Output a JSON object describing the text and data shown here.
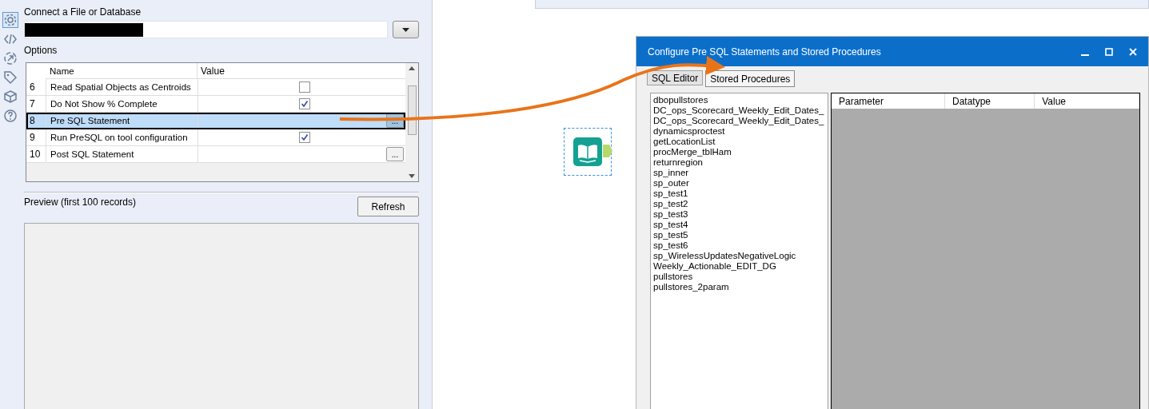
{
  "left_panel": {
    "section_title": "Connect a File or Database",
    "options_label": "Options",
    "options_table": {
      "columns": [
        "Name",
        "Value"
      ],
      "rows": [
        {
          "number": "6",
          "name": "Read Spatial Objects as Centroids",
          "kind": "checkbox",
          "checked": false,
          "selected": false
        },
        {
          "number": "7",
          "name": "Do Not Show % Complete",
          "kind": "checkbox",
          "checked": true,
          "selected": false
        },
        {
          "number": "8",
          "name": "Pre SQL Statement",
          "kind": "ellipsis",
          "button": "...",
          "selected": true
        },
        {
          "number": "9",
          "name": "Run PreSQL on tool configuration",
          "kind": "checkbox",
          "checked": true,
          "selected": false
        },
        {
          "number": "10",
          "name": "Post SQL Statement",
          "kind": "ellipsis",
          "button": "...",
          "selected": false
        }
      ]
    },
    "preview_label": "Preview (first 100 records)",
    "refresh_button": "Refresh"
  },
  "dialog": {
    "title": "Configure Pre SQL Statements and Stored Procedures",
    "tabs": [
      {
        "label": "SQL Editor",
        "selected": false
      },
      {
        "label": "Stored Procedures",
        "selected": true
      }
    ],
    "procedures": [
      {
        "label": "dbopullstores"
      },
      {
        "label": "DC_ops_Scorecard_Weekly_Edit_Dates_"
      },
      {
        "label": "DC_ops_Scorecard_Weekly_Edit_Dates_"
      },
      {
        "label": "dynamicsproctest"
      },
      {
        "label": "getLocationList"
      },
      {
        "label": "procMerge_tblHam"
      },
      {
        "label": "returnregion"
      },
      {
        "label": "sp_inner"
      },
      {
        "label": "sp_outer"
      },
      {
        "label": "sp_test1"
      },
      {
        "label": "sp_test2"
      },
      {
        "label": "sp_test3"
      },
      {
        "label": "sp_test4"
      },
      {
        "label": "sp_test5"
      },
      {
        "label": "sp_test6"
      },
      {
        "label": "sp_WirelessUpdatesNegativeLogic"
      },
      {
        "label": "Weekly_Actionable_EDIT_DG"
      },
      {
        "label": "pullstores"
      },
      {
        "label": "pullstores_2param"
      }
    ],
    "parameter_columns": [
      "Parameter",
      "Datatype",
      "Value"
    ]
  }
}
